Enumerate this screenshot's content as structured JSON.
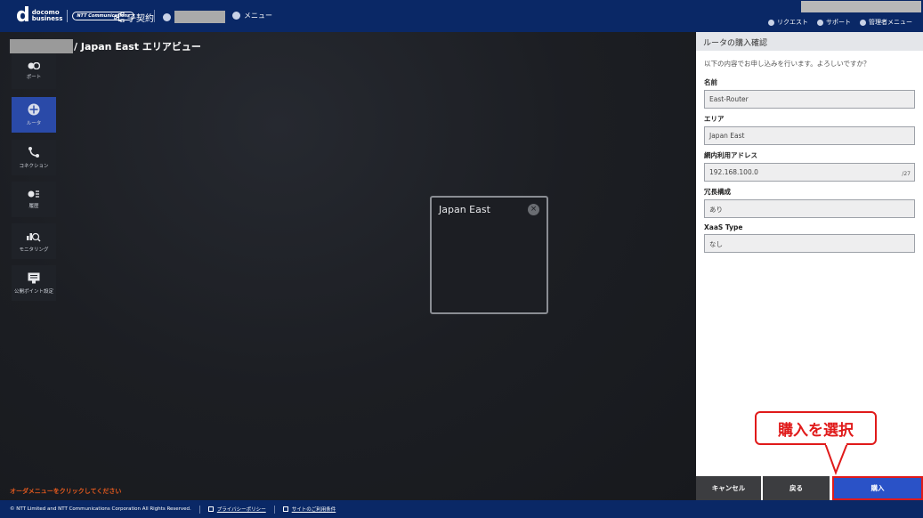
{
  "header": {
    "logo_top": "docomo",
    "logo_bottom": "business",
    "ntt_logo": "NTT Communications",
    "contract_label": "子契約",
    "menu_label": "メニュー",
    "links": [
      "リクエスト",
      "サポート",
      "管理者メニュー"
    ]
  },
  "breadcrumb": {
    "suffix": "/ Japan East エリアビュー"
  },
  "sidebar": {
    "items": [
      {
        "label": "ポート"
      },
      {
        "label": "ルータ"
      },
      {
        "label": "コネクション"
      },
      {
        "label": "履歴"
      },
      {
        "label": "モニタリング"
      },
      {
        "label": "公開ポイント設定"
      }
    ],
    "active_index": 1
  },
  "area_card": {
    "title": "Japan East",
    "close_glyph": "×"
  },
  "order_hint": "オーダメニューをクリックしてください",
  "panel": {
    "title": "ルータの購入確認",
    "description": "以下の内容でお申し込みを行います。よろしいですか？",
    "fields": [
      {
        "label": "名前",
        "value": "East-Router",
        "suffix": ""
      },
      {
        "label": "エリア",
        "value": "Japan East",
        "suffix": ""
      },
      {
        "label": "網内利用アドレス",
        "value": "192.168.100.0",
        "suffix": "/27"
      },
      {
        "label": "冗長構成",
        "value": "あり",
        "suffix": ""
      },
      {
        "label": "XaaS Type",
        "value": "なし",
        "suffix": ""
      }
    ],
    "buttons": {
      "cancel": "キャンセル",
      "back": "戻る",
      "buy": "購入"
    }
  },
  "callout": "購入を選択",
  "footer": {
    "copyright": "© NTT Limited and NTT Communications Corporation All Rights Reserved.",
    "privacy": "プライバシーポリシー",
    "terms": "サイトのご利用条件"
  },
  "colors": {
    "header_bg": "#0a2866",
    "active_sidebar": "#2a4aa8",
    "buy_button": "#2a52c7",
    "annotation_red": "#e01a1a",
    "hint_orange": "#e65a1e"
  }
}
